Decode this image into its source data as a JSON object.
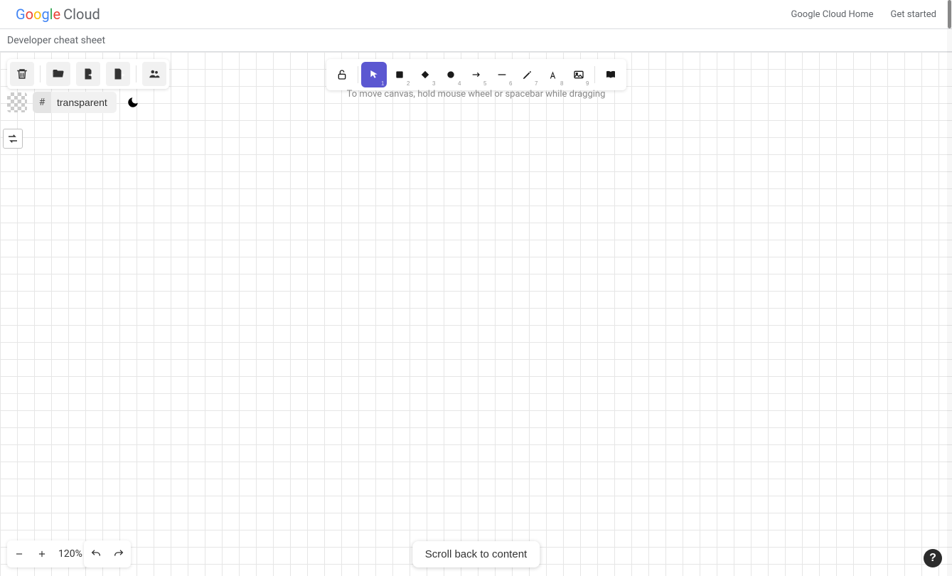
{
  "header": {
    "logo_parts": {
      "g1": "G",
      "o1": "o",
      "o2": "o",
      "g2": "g",
      "l1": "l",
      "e1": "e"
    },
    "logo_cloud": "Cloud",
    "nav": {
      "home": "Google Cloud Home",
      "get_started": "Get started"
    }
  },
  "subheader": {
    "title": "Developer cheat sheet"
  },
  "file_toolbar": {
    "trash": "trash",
    "open": "open",
    "save": "save",
    "export": "export",
    "share": "share"
  },
  "color": {
    "hash": "#",
    "value": "transparent"
  },
  "tools": {
    "lock_key": "",
    "select_key": "1",
    "rect_key": "2",
    "diamond_key": "3",
    "ellipse_key": "4",
    "arrow_key": "5",
    "line_key": "6",
    "draw_key": "7",
    "text_key": "8",
    "image_key": "9"
  },
  "hint": "To move canvas, hold mouse wheel or spacebar while dragging",
  "zoom": {
    "level": "120%"
  },
  "scroll_back": "Scroll back to content",
  "help": "?"
}
